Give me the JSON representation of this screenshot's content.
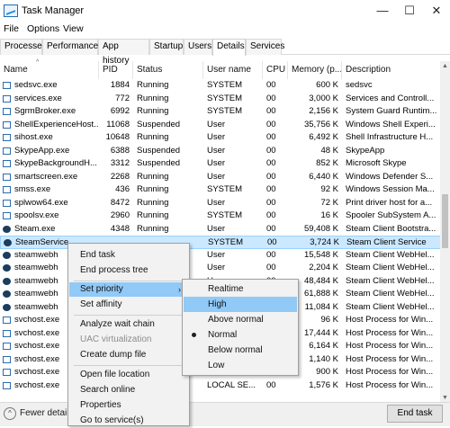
{
  "window": {
    "title": "Task Manager",
    "controls": [
      "—",
      "☐",
      "✕"
    ]
  },
  "menu": [
    "File",
    "Options",
    "View"
  ],
  "tabs": [
    "Processes",
    "Performance",
    "App history",
    "Startup",
    "Users",
    "Details",
    "Services"
  ],
  "active_tab": "Details",
  "columns": [
    "Name",
    "PID",
    "Status",
    "User name",
    "CPU",
    "Memory (p...",
    "Description"
  ],
  "rows": [
    {
      "name": "sedsvc.exe",
      "pid": "1884",
      "status": "Running",
      "user": "SYSTEM",
      "cpu": "00",
      "mem": "600 K",
      "desc": "sedsvc"
    },
    {
      "name": "services.exe",
      "pid": "772",
      "status": "Running",
      "user": "SYSTEM",
      "cpu": "00",
      "mem": "3,000 K",
      "desc": "Services and Controll..."
    },
    {
      "name": "SgrmBroker.exe",
      "pid": "6992",
      "status": "Running",
      "user": "SYSTEM",
      "cpu": "00",
      "mem": "2,156 K",
      "desc": "System Guard Runtim..."
    },
    {
      "name": "ShellExperienceHost...",
      "pid": "11068",
      "status": "Suspended",
      "user": "User",
      "cpu": "00",
      "mem": "35,756 K",
      "desc": "Windows Shell Experi..."
    },
    {
      "name": "sihost.exe",
      "pid": "10648",
      "status": "Running",
      "user": "User",
      "cpu": "00",
      "mem": "6,492 K",
      "desc": "Shell Infrastructure H..."
    },
    {
      "name": "SkypeApp.exe",
      "pid": "6388",
      "status": "Suspended",
      "user": "User",
      "cpu": "00",
      "mem": "48 K",
      "desc": "SkypeApp"
    },
    {
      "name": "SkypeBackgroundH...",
      "pid": "3312",
      "status": "Suspended",
      "user": "User",
      "cpu": "00",
      "mem": "852 K",
      "desc": "Microsoft Skype"
    },
    {
      "name": "smartscreen.exe",
      "pid": "2268",
      "status": "Running",
      "user": "User",
      "cpu": "00",
      "mem": "6,440 K",
      "desc": "Windows Defender S..."
    },
    {
      "name": "smss.exe",
      "pid": "436",
      "status": "Running",
      "user": "SYSTEM",
      "cpu": "00",
      "mem": "92 K",
      "desc": "Windows Session Ma..."
    },
    {
      "name": "splwow64.exe",
      "pid": "8472",
      "status": "Running",
      "user": "User",
      "cpu": "00",
      "mem": "72 K",
      "desc": "Print driver host for a..."
    },
    {
      "name": "spoolsv.exe",
      "pid": "2960",
      "status": "Running",
      "user": "SYSTEM",
      "cpu": "00",
      "mem": "16 K",
      "desc": "Spooler SubSystem A..."
    },
    {
      "name": "Steam.exe",
      "pid": "4348",
      "status": "Running",
      "user": "User",
      "cpu": "00",
      "mem": "59,408 K",
      "desc": "Steam Client Bootstra..."
    },
    {
      "name": "SteamService",
      "pid": "",
      "status": "",
      "user": "SYSTEM",
      "cpu": "00",
      "mem": "3,724 K",
      "desc": "Steam Client Service",
      "selected": true
    },
    {
      "name": "steamwebh",
      "pid": "",
      "status": "",
      "user": "User",
      "cpu": "00",
      "mem": "15,548 K",
      "desc": "Steam Client WebHel..."
    },
    {
      "name": "steamwebh",
      "pid": "",
      "status": "",
      "user": "User",
      "cpu": "00",
      "mem": "2,204 K",
      "desc": "Steam Client WebHel..."
    },
    {
      "name": "steamwebh",
      "pid": "",
      "status": "",
      "user": "User",
      "cpu": "00",
      "mem": "48,484 K",
      "desc": "Steam Client WebHel..."
    },
    {
      "name": "steamwebh",
      "pid": "",
      "status": "",
      "user": "User",
      "cpu": "00",
      "mem": "61,888 K",
      "desc": "Steam Client WebHel..."
    },
    {
      "name": "steamwebh",
      "pid": "",
      "status": "",
      "user": "User",
      "cpu": "00",
      "mem": "11,084 K",
      "desc": "Steam Client WebHel..."
    },
    {
      "name": "svchost.exe",
      "pid": "",
      "status": "",
      "user": "",
      "cpu": "00",
      "mem": "96 K",
      "desc": "Host Process for Win..."
    },
    {
      "name": "svchost.exe",
      "pid": "",
      "status": "",
      "user": "",
      "cpu": "00",
      "mem": "17,444 K",
      "desc": "Host Process for Win..."
    },
    {
      "name": "svchost.exe",
      "pid": "",
      "status": "",
      "user": "",
      "cpu": "00",
      "mem": "6,164 K",
      "desc": "Host Process for Win..."
    },
    {
      "name": "svchost.exe",
      "pid": "",
      "status": "",
      "user": "",
      "cpu": "00",
      "mem": "1,140 K",
      "desc": "Host Process for Win..."
    },
    {
      "name": "svchost.exe",
      "pid": "",
      "status": "",
      "user": "",
      "cpu": "00",
      "mem": "900 K",
      "desc": "Host Process for Win..."
    },
    {
      "name": "svchost.exe",
      "pid": "",
      "status": "",
      "user": "LOCAL SE...",
      "cpu": "00",
      "mem": "1,576 K",
      "desc": "Host Process for Win..."
    }
  ],
  "selected_partial": {
    "pid": "8624",
    "status": "Runnin"
  },
  "context_menu": {
    "items": [
      "End task",
      "End process tree",
      "Set priority",
      "Set affinity",
      "Analyze wait chain",
      "UAC virtualization",
      "Create dump file",
      "Open file location",
      "Search online",
      "Properties",
      "Go to service(s)"
    ],
    "highlighted": "Set priority",
    "disabled": "UAC virtualization"
  },
  "priority_submenu": {
    "items": [
      "Realtime",
      "High",
      "Above normal",
      "Normal",
      "Below normal",
      "Low"
    ],
    "highlighted": "High",
    "checked": "Normal"
  },
  "footer": {
    "fewer_details": "Fewer details",
    "end_task": "End task"
  },
  "colors": {
    "selection": "#cce8ff",
    "menu_highlight": "#91c9f7"
  },
  "icons": [
    "task-manager-icon",
    "window-minimize-icon",
    "window-maximize-icon",
    "window-close-icon",
    "process-icon",
    "steam-icon",
    "chevron-up-icon",
    "submenu-arrow-icon",
    "radio-bullet-icon"
  ]
}
